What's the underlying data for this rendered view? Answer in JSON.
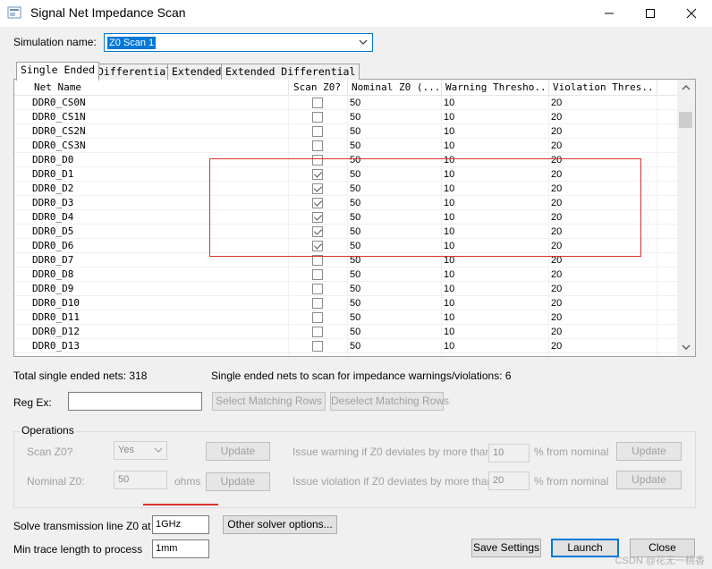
{
  "window": {
    "title": "Signal Net Impedance Scan"
  },
  "sim": {
    "label": "Simulation name:",
    "value": "Z0 Scan 1"
  },
  "tabs": [
    "Single Ended",
    "Differential",
    "Extended",
    "Extended Differential"
  ],
  "grid": {
    "headers": [
      "Net Name",
      "Scan Z0?",
      "Nominal Z0 (...",
      "Warning Thresho...",
      "Violation Thres..."
    ],
    "rows": [
      {
        "name": "DDR0_CS0N",
        "scan": false,
        "nominal": "50",
        "warning": "10",
        "violation": "20"
      },
      {
        "name": "DDR0_CS1N",
        "scan": false,
        "nominal": "50",
        "warning": "10",
        "violation": "20"
      },
      {
        "name": "DDR0_CS2N",
        "scan": false,
        "nominal": "50",
        "warning": "10",
        "violation": "20"
      },
      {
        "name": "DDR0_CS3N",
        "scan": false,
        "nominal": "50",
        "warning": "10",
        "violation": "20"
      },
      {
        "name": "DDR0_D0",
        "scan": false,
        "nominal": "50",
        "warning": "10",
        "violation": "20"
      },
      {
        "name": "DDR0_D1",
        "scan": true,
        "nominal": "50",
        "warning": "10",
        "violation": "20"
      },
      {
        "name": "DDR0_D2",
        "scan": true,
        "nominal": "50",
        "warning": "10",
        "violation": "20"
      },
      {
        "name": "DDR0_D3",
        "scan": true,
        "nominal": "50",
        "warning": "10",
        "violation": "20"
      },
      {
        "name": "DDR0_D4",
        "scan": true,
        "nominal": "50",
        "warning": "10",
        "violation": "20"
      },
      {
        "name": "DDR0_D5",
        "scan": true,
        "nominal": "50",
        "warning": "10",
        "violation": "20"
      },
      {
        "name": "DDR0_D6",
        "scan": true,
        "nominal": "50",
        "warning": "10",
        "violation": "20"
      },
      {
        "name": "DDR0_D7",
        "scan": false,
        "nominal": "50",
        "warning": "10",
        "violation": "20"
      },
      {
        "name": "DDR0_D8",
        "scan": false,
        "nominal": "50",
        "warning": "10",
        "violation": "20"
      },
      {
        "name": "DDR0_D9",
        "scan": false,
        "nominal": "50",
        "warning": "10",
        "violation": "20"
      },
      {
        "name": "DDR0_D10",
        "scan": false,
        "nominal": "50",
        "warning": "10",
        "violation": "20"
      },
      {
        "name": "DDR0_D11",
        "scan": false,
        "nominal": "50",
        "warning": "10",
        "violation": "20"
      },
      {
        "name": "DDR0_D12",
        "scan": false,
        "nominal": "50",
        "warning": "10",
        "violation": "20"
      },
      {
        "name": "DDR0_D13",
        "scan": false,
        "nominal": "50",
        "warning": "10",
        "violation": "20"
      }
    ]
  },
  "summary": {
    "total": "Total single ended nets: 318",
    "toscan": "Single ended nets to scan for impedance warnings/violations: 6"
  },
  "regex": {
    "label": "Reg Ex:",
    "value": "",
    "select_btn": "Select Matching Rows",
    "deselect_btn": "Deselect Matching Rows"
  },
  "operations": {
    "title": "Operations",
    "scan_label": "Scan Z0?",
    "scan_value": "Yes",
    "nominal_label": "Nominal Z0:",
    "nominal_value": "50",
    "nominal_unit": "ohms",
    "update": "Update",
    "warn_label": "Issue warning if Z0 deviates by more than",
    "warn_value": "10",
    "viol_label": "Issue violation if Z0 deviates by more than",
    "viol_value": "20",
    "pct_label": "% from nominal"
  },
  "solver": {
    "label": "Solve transmission line Z0 at",
    "value": "1GHz",
    "other_btn": "Other solver options...",
    "min_label": "Min trace length to process",
    "min_value": "1mm"
  },
  "footer": {
    "save": "Save Settings",
    "launch": "Launch",
    "close": "Close",
    "watermark": "CSDN @花无一桃香"
  },
  "colors": {
    "accent": "#0078d7",
    "highlight_box": "#d9342b"
  }
}
